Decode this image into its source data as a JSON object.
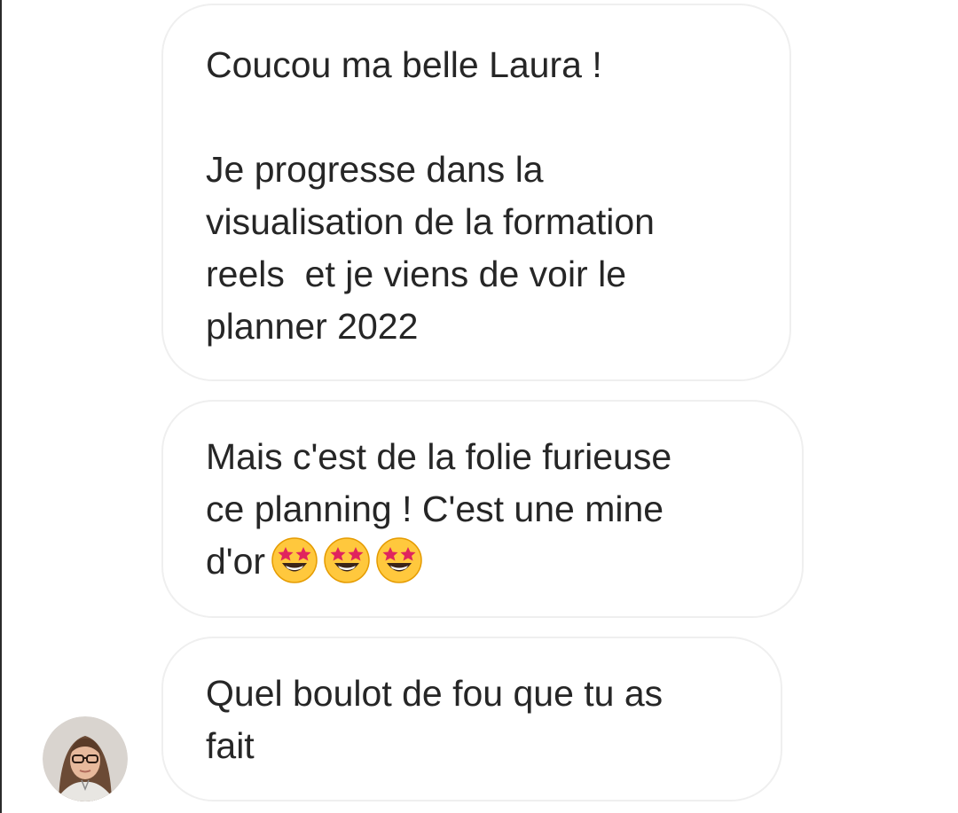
{
  "messages": [
    {
      "lines": [
        "Coucou ma belle Laura !",
        "",
        "Je progresse dans la",
        "visualisation de la formation",
        "reels  et je viens de voir le",
        "planner 2022"
      ]
    },
    {
      "lines": [
        "Mais c'est de la folie furieuse",
        "ce planning ! C'est une mine",
        "d'or"
      ],
      "emoji": [
        "star-struck-emoji",
        "star-struck-emoji",
        "star-struck-emoji"
      ]
    },
    {
      "lines": [
        "Quel boulot de fou que tu as",
        "fait"
      ]
    }
  ],
  "colors": {
    "bubble_border": "#efefef",
    "text": "#262626",
    "background": "#ffffff"
  },
  "avatar": {
    "icon": "profile-photo-avatar"
  }
}
